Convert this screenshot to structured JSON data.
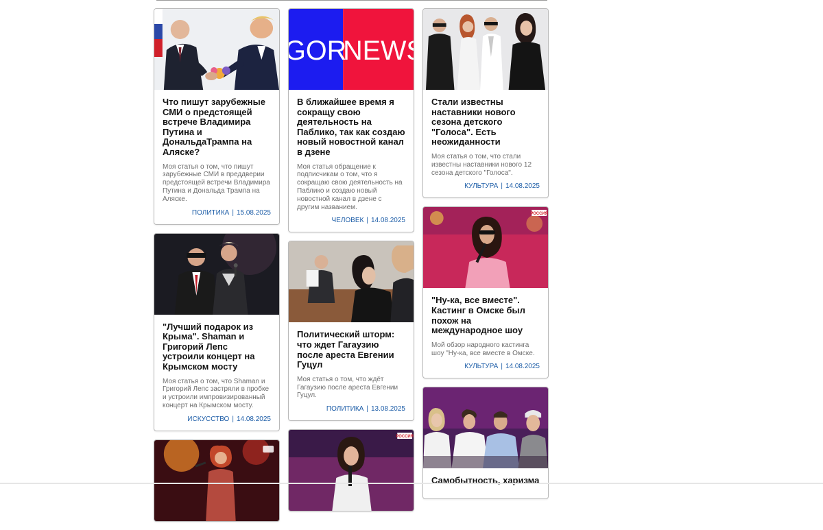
{
  "columns": [
    {
      "cards": [
        {
          "title": "Что пишут зарубежные СМИ о предстоящей встрече Владимира Путина и ДональдаТрампа на Аляске?",
          "excerpt": "Моя статья о том, что пишут зарубежные СМИ в преддверии предстоящей встречи Владимира Путина и Дональда Трампа на Аляске.",
          "category": "ПОЛИТИКА",
          "date": "15.08.2025",
          "image": "handshake-photo"
        },
        {
          "title": "\"Лучший подарок из Крыма\". Shaman и Григорий Лепс устроили концерт на Крымском мосту",
          "excerpt": "Моя статья о том, что Shaman и Григорий Лепс застряли в пробке и устроили импровизированный концерт на Крымском мосту.",
          "category": "ИСКУССТВО",
          "date": "14.08.2025",
          "image": "concert-photo"
        },
        {
          "title": "",
          "excerpt": "",
          "category": "",
          "date": "",
          "image": "singer-stage-photo"
        }
      ]
    },
    {
      "cards": [
        {
          "title": "В ближайшее время я сокращу свою деятельность на Паблико, так как создаю новый новостной канал в дзене",
          "excerpt": "Моя статья обращение к подписчикам о том, что я сокращаю свою деятельность на Паблико и создаю новый новостной канал в дзене с другим названием.",
          "category": "ЧЕЛОВЕК",
          "date": "14.08.2025",
          "image": "gornews-logo",
          "logo_left": "GOR",
          "logo_right": "NEWS",
          "logo_left_color": "#1c1cf0",
          "logo_right_color": "#f0143c"
        },
        {
          "title": "Политический шторм: что ждет Гагаузию после ареста Евгении Гуцул",
          "excerpt": "Моя статья о том, что ждёт Гагаузию после ареста Евгении Гуцул.",
          "category": "ПОЛИТИКА",
          "date": "13.08.2025",
          "image": "courtroom-photo"
        },
        {
          "title": "",
          "excerpt": "",
          "category": "",
          "date": "",
          "image": "singer-microphone-photo",
          "badge": "РОССИЯ"
        }
      ]
    },
    {
      "cards": [
        {
          "title": "Стали известны наставники нового сезона детского \"Голоса\". Есть неожиданности",
          "excerpt": "Моя статья о том, что стали известны наставники нового 12 сезона детского \"Голоса\".",
          "category": "КУЛЬТУРА",
          "date": "14.08.2025",
          "image": "mentors-photo"
        },
        {
          "title": "\"Ну-ка, все вместе\". Кастинг в Омске был похож на международное шоу",
          "excerpt": "Мой обзор народного кастинга шоу \"Ну-ка, все вместе в Омске.",
          "category": "КУЛЬТУРА",
          "date": "14.08.2025",
          "image": "casting-singer-photo",
          "badge": "РОССИЯ"
        },
        {
          "title": "Самобытность, харизма",
          "excerpt": "",
          "category": "",
          "date": "",
          "image": "jury-photo"
        }
      ]
    }
  ]
}
